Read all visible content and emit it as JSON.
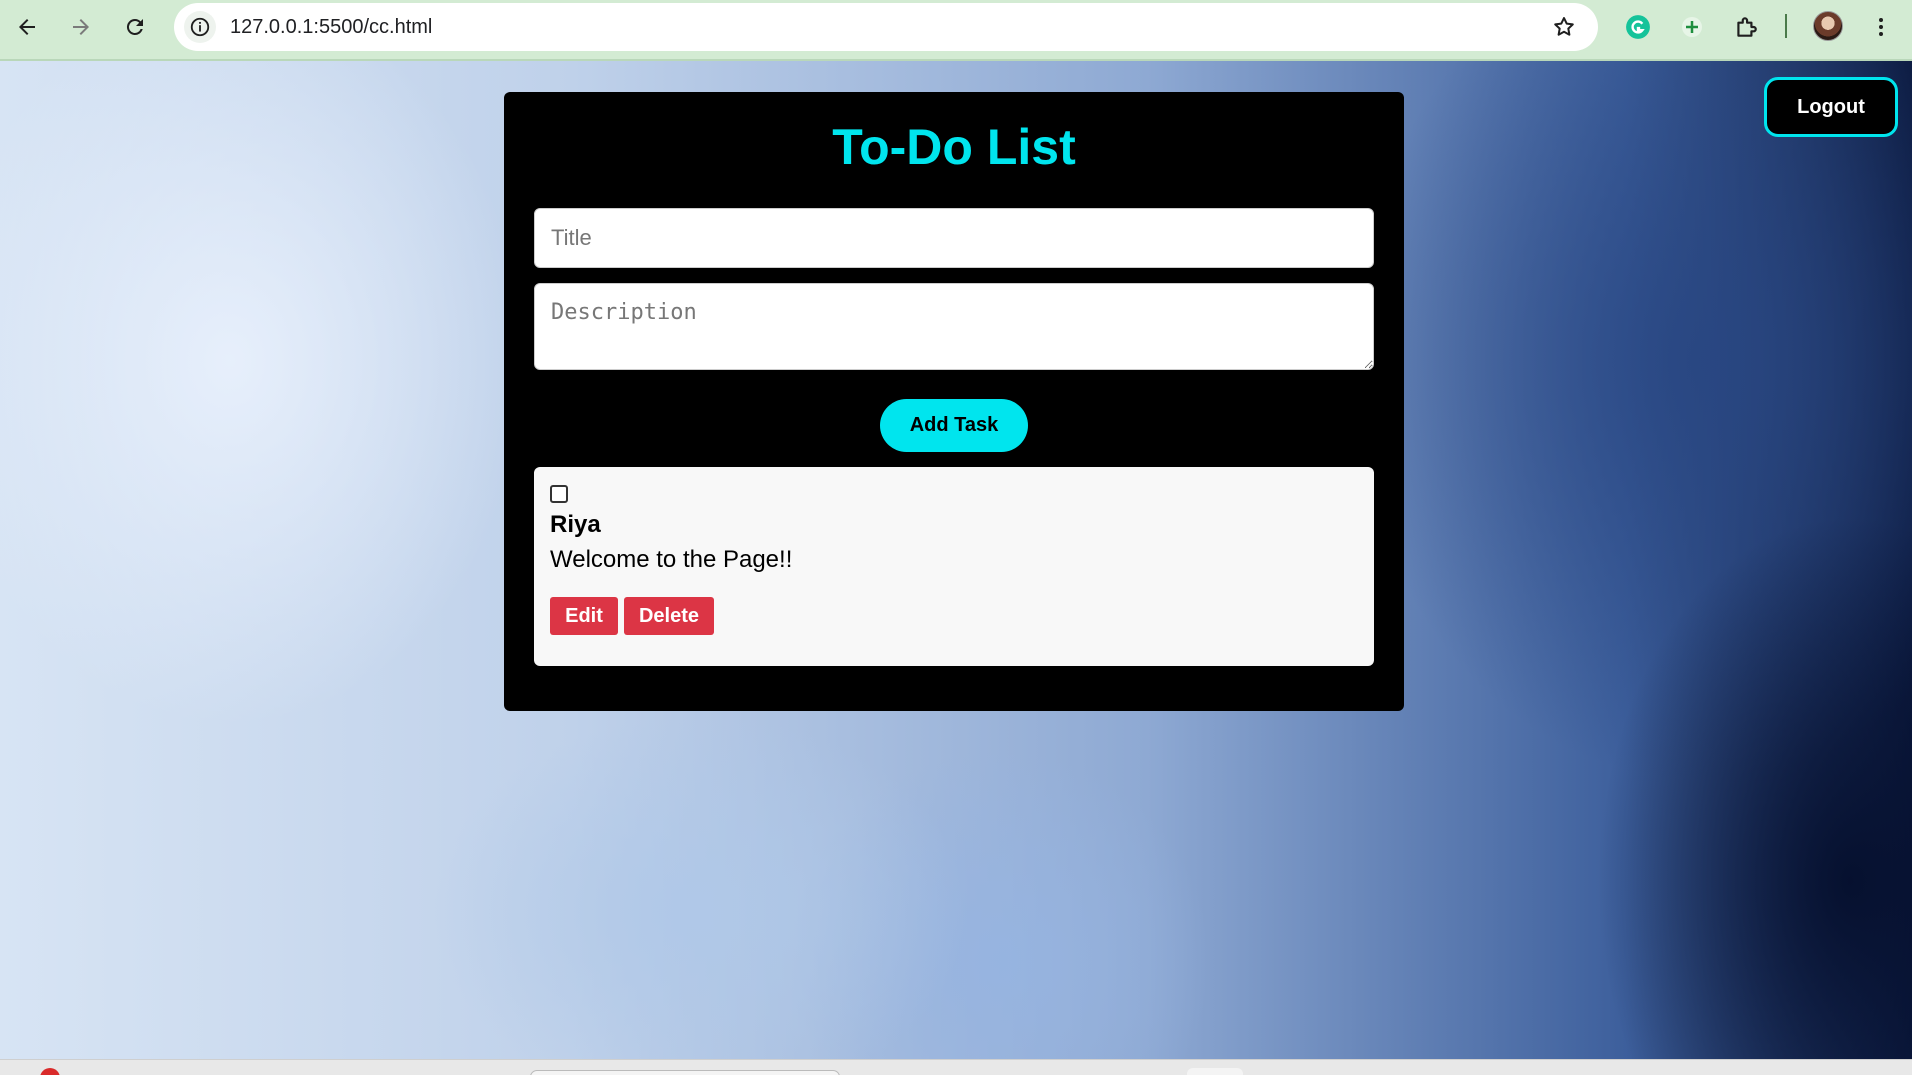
{
  "browser": {
    "url": "127.0.0.1:5500/cc.html",
    "icons": [
      "back-icon",
      "forward-icon",
      "reload-icon",
      "site-info-icon",
      "bookmark-star-icon",
      "grammarly-icon",
      "add-extension-icon",
      "extensions-puzzle-icon",
      "profile-avatar",
      "more-menu-icon"
    ]
  },
  "header": {
    "logout_label": "Logout"
  },
  "todo": {
    "heading": "To-Do List",
    "title_placeholder": "Title",
    "description_placeholder": "Description",
    "add_label": "Add Task"
  },
  "tasks": [
    {
      "title": "Riya",
      "description": "Welcome to the Page!!",
      "checked": false,
      "edit_label": "Edit",
      "delete_label": "Delete"
    }
  ],
  "colors": {
    "accent": "#00e5ee",
    "card": "#000000",
    "danger": "#dc3545",
    "chrome": "#d3ebd3"
  }
}
